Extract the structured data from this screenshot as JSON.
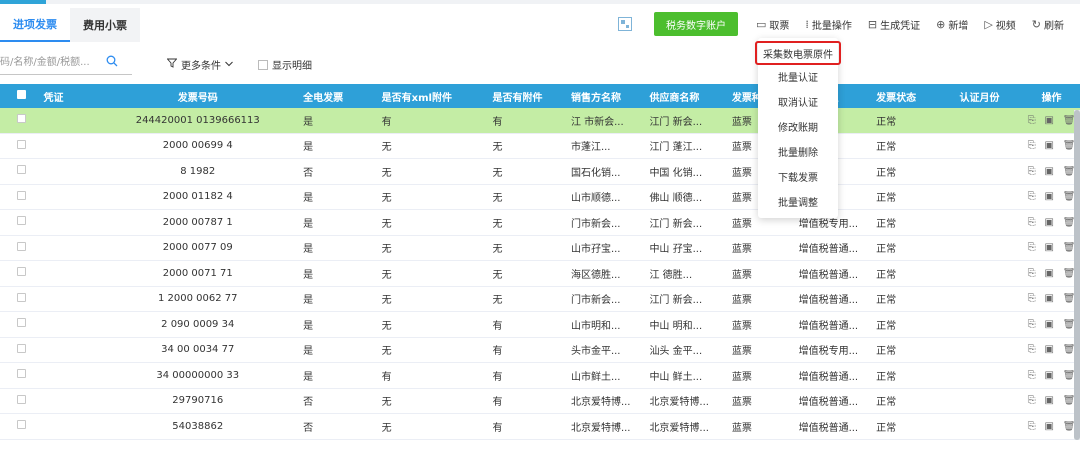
{
  "tabs": [
    {
      "label": "进项发票",
      "active": true
    },
    {
      "label": "费用小票",
      "active": false
    }
  ],
  "toolbar": {
    "tax_account_label": "税务数字账户",
    "items": [
      {
        "icon": "inbox-icon",
        "glyph": "▭",
        "label": "取票"
      },
      {
        "icon": "batch-icon",
        "glyph": "⁞",
        "label": "批量操作"
      },
      {
        "icon": "voucher-icon",
        "glyph": "⊟",
        "label": "生成凭证"
      },
      {
        "icon": "plus-circle-icon",
        "glyph": "⊕",
        "label": "新增"
      },
      {
        "icon": "play-circle-icon",
        "glyph": "▷",
        "label": "视频"
      },
      {
        "icon": "refresh-icon",
        "glyph": "↻",
        "label": "刷新"
      }
    ]
  },
  "filters": {
    "search_placeholder": "码/名称/金额/税额...",
    "more_conditions_label": "更多条件",
    "show_detail_label": "显示明细"
  },
  "dropdown": {
    "items": [
      "采集数电票原件",
      "批量认证",
      "取消认证",
      "修改账期",
      "批量删除",
      "下载发票",
      "批量调整"
    ],
    "highlighted_index": 0
  },
  "table": {
    "columns": [
      "凭证",
      "发票号码",
      "全电发票",
      "是否有xml附件",
      "是否有附件",
      "销售方名称",
      "供应商名称",
      "发票种类",
      "发票类型",
      "发票状态",
      "认证月份",
      "操作"
    ],
    "rows": [
      {
        "no": "244420001 0139666113",
        "qd": "是",
        "xml": "有",
        "att": "有",
        "seller": "江 市新会...",
        "supplier": "江门 新会...",
        "kind": "蓝票",
        "type": "",
        "status": "正常",
        "selected": true
      },
      {
        "no": "2000 00699 4",
        "qd": "是",
        "xml": "无",
        "att": "无",
        "seller": "市蓬江...",
        "supplier": "江门 蓬江...",
        "kind": "蓝票",
        "type": "",
        "status": "正常",
        "selected": false
      },
      {
        "no": "8 1982",
        "qd": "否",
        "xml": "无",
        "att": "无",
        "seller": "国石化销...",
        "supplier": "中国 化销...",
        "kind": "蓝票",
        "type": "",
        "status": "正常",
        "selected": false
      },
      {
        "no": "2000 01182 4",
        "qd": "是",
        "xml": "无",
        "att": "无",
        "seller": "山市顺德...",
        "supplier": "佛山 顺德...",
        "kind": "蓝票",
        "type": "",
        "status": "正常",
        "selected": false
      },
      {
        "no": "2000 00787 1",
        "qd": "是",
        "xml": "无",
        "att": "无",
        "seller": "门市新会...",
        "supplier": "江门 新会...",
        "kind": "蓝票",
        "type": "增值税专用...",
        "status": "正常",
        "selected": false
      },
      {
        "no": "2000 0077 09",
        "qd": "是",
        "xml": "无",
        "att": "无",
        "seller": "山市孖宝...",
        "supplier": "中山 孖宝...",
        "kind": "蓝票",
        "type": "增值税普通...",
        "status": "正常",
        "selected": false
      },
      {
        "no": "2000 0071 71",
        "qd": "是",
        "xml": "无",
        "att": "无",
        "seller": "海区德胜...",
        "supplier": "江 德胜...",
        "kind": "蓝票",
        "type": "增值税普通...",
        "status": "正常",
        "selected": false
      },
      {
        "no": "1 2000 0062 77",
        "qd": "是",
        "xml": "无",
        "att": "无",
        "seller": "门市新会...",
        "supplier": "江门 新会...",
        "kind": "蓝票",
        "type": "增值税普通...",
        "status": "正常",
        "selected": false
      },
      {
        "no": "2 090 0009 34",
        "qd": "是",
        "xml": "无",
        "att": "有",
        "seller": "山市明和...",
        "supplier": "中山 明和...",
        "kind": "蓝票",
        "type": "增值税普通...",
        "status": "正常",
        "selected": false
      },
      {
        "no": "34 00 0034 77",
        "qd": "是",
        "xml": "无",
        "att": "有",
        "seller": "头市金平...",
        "supplier": "汕头 金平...",
        "kind": "蓝票",
        "type": "增值税专用...",
        "status": "正常",
        "selected": false
      },
      {
        "no": "34 00000000 33",
        "qd": "是",
        "xml": "有",
        "att": "有",
        "seller": "山市鲜土...",
        "supplier": "中山 鲜土...",
        "kind": "蓝票",
        "type": "增值税普通...",
        "status": "正常",
        "selected": false
      },
      {
        "no": "29790716",
        "qd": "否",
        "xml": "无",
        "att": "有",
        "seller": "北京爱特博...",
        "supplier": "北京爱特博...",
        "kind": "蓝票",
        "type": "增值税普通...",
        "status": "正常",
        "selected": false
      },
      {
        "no": "54038862",
        "qd": "否",
        "xml": "无",
        "att": "有",
        "seller": "北京爱特博...",
        "supplier": "北京爱特博...",
        "kind": "蓝票",
        "type": "增值税普通...",
        "status": "正常",
        "selected": false
      }
    ],
    "row_actions": [
      "view-icon",
      "folder-icon",
      "trash-icon"
    ]
  },
  "colors": {
    "accent": "#2d8cf0",
    "header": "#2ea0d8",
    "green": "#4cbe2e",
    "selected_row": "#c4eda5",
    "highlight": "#e02020"
  }
}
